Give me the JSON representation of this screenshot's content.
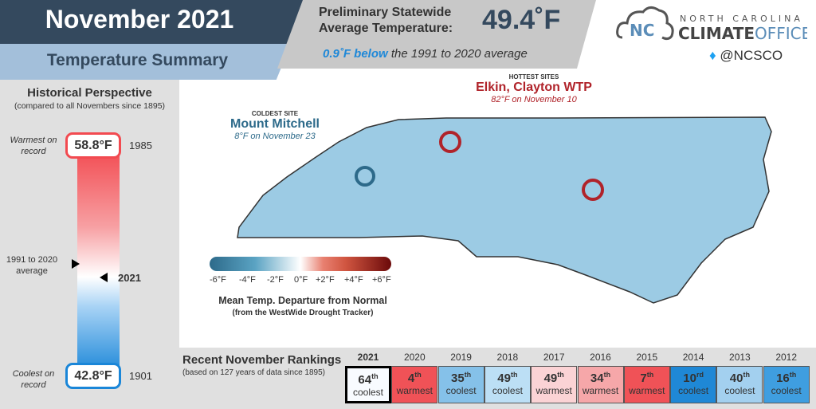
{
  "header": {
    "title": "November 2021",
    "subtitle": "Temperature Summary",
    "prelim_label_1": "Preliminary Statewide",
    "prelim_label_2": "Average Temperature:",
    "avg_temp": "49.4˚F",
    "departure_value": "0.9˚F below",
    "departure_rest": " the 1991 to 2020 average"
  },
  "logo": {
    "line1": "NORTH CAROLINA",
    "line2a": "CLIMATE",
    "line2b": "OFFICE",
    "mark": "NC",
    "twitter": "@NCSCO",
    "twitter_icon": "twitter-bird-icon"
  },
  "historical": {
    "title": "Historical Perspective",
    "subtitle": "(compared to all Novembers since 1895)",
    "warmest_label": "Warmest on record",
    "warmest_value": "58.8°F",
    "warmest_year": "1985",
    "coolest_label": "Coolest on record",
    "coolest_value": "42.8°F",
    "coolest_year": "1901",
    "normal_label": "1991 to 2020 average",
    "current_year": "2021"
  },
  "map": {
    "coldest_heading": "COLDEST SITE",
    "coldest_name": "Mount Mitchell",
    "coldest_detail": "8°F on November 23",
    "hottest_heading": "HOTTEST SITES",
    "hottest_name": "Elkin, Clayton WTP",
    "hottest_detail": "82°F on November 10",
    "legend_ticks": [
      "-6°F",
      "-4°F",
      "-2°F",
      "0°F",
      "+2°F",
      "+4°F",
      "+6°F"
    ],
    "legend_title": "Mean Temp. Departure from Normal",
    "legend_source": "(from the WestWide Drought Tracker)",
    "colors": {
      "cold": "#2d6a8a",
      "hot": "#b0232a",
      "map_fill": "#9ccbe4"
    }
  },
  "rankings": {
    "title": "Recent November Rankings",
    "subtitle": "(based on 127 years of data since 1895)",
    "items": [
      {
        "year": "2021",
        "rank": "64",
        "suffix": "th",
        "label": "coolest",
        "color": "#f8fbff"
      },
      {
        "year": "2020",
        "rank": "4",
        "suffix": "th",
        "label": "warmest",
        "color": "#f05257"
      },
      {
        "year": "2019",
        "rank": "35",
        "suffix": "th",
        "label": "coolest",
        "color": "#85c1e9"
      },
      {
        "year": "2018",
        "rank": "49",
        "suffix": "th",
        "label": "coolest",
        "color": "#bcdff5"
      },
      {
        "year": "2017",
        "rank": "49",
        "suffix": "th",
        "label": "warmest",
        "color": "#fbd3d5"
      },
      {
        "year": "2016",
        "rank": "34",
        "suffix": "th",
        "label": "warmest",
        "color": "#f6a7a9"
      },
      {
        "year": "2015",
        "rank": "7",
        "suffix": "th",
        "label": "warmest",
        "color": "#f05257"
      },
      {
        "year": "2014",
        "rank": "10",
        "suffix": "rd",
        "label": "coolest",
        "color": "#1f88d6"
      },
      {
        "year": "2013",
        "rank": "40",
        "suffix": "th",
        "label": "coolest",
        "color": "#a3d0ef"
      },
      {
        "year": "2012",
        "rank": "16",
        "suffix": "th",
        "label": "coolest",
        "color": "#3f9ee0"
      }
    ]
  }
}
